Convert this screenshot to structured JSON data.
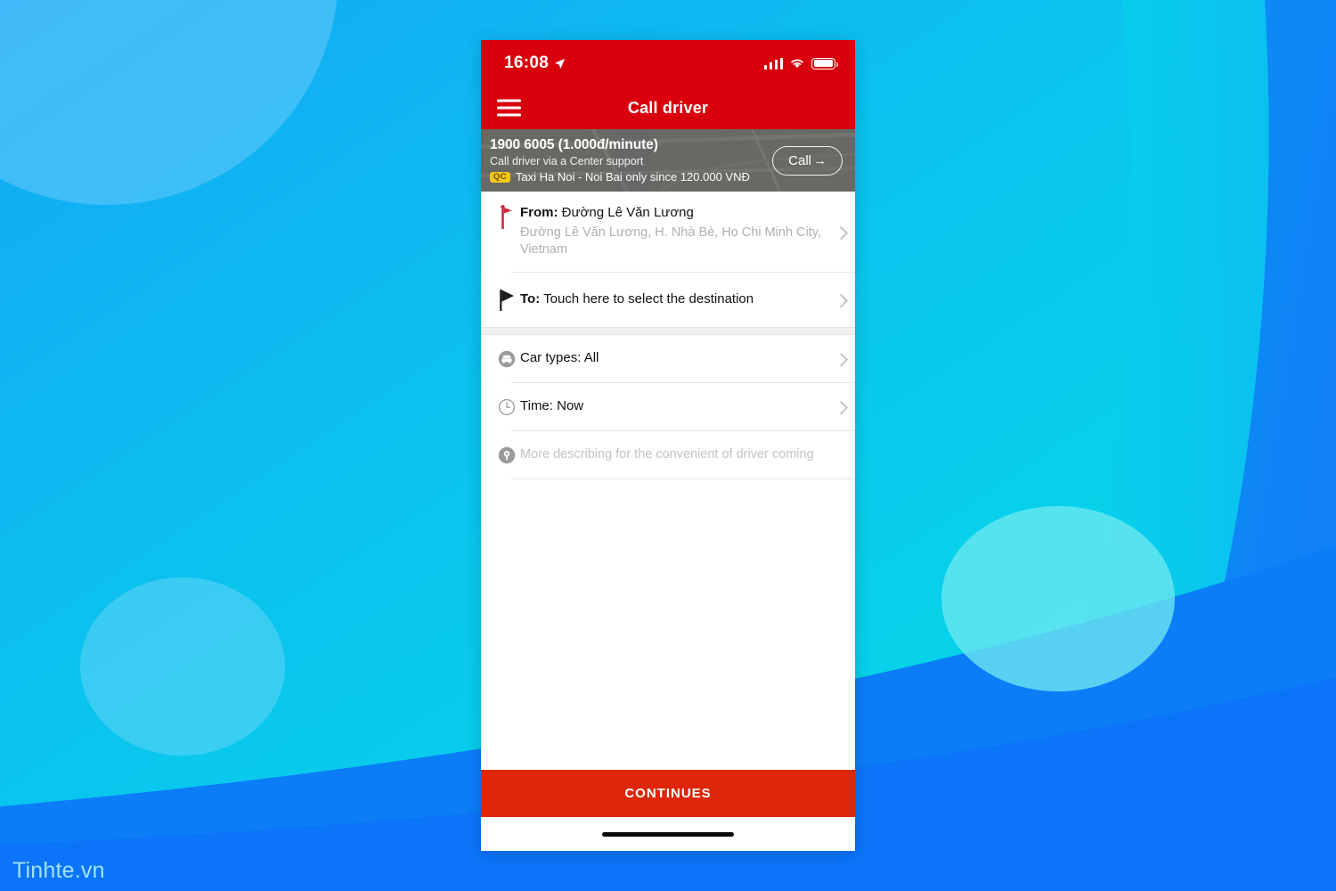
{
  "background": {
    "watermark": "Tinhte.vn",
    "colors": {
      "blue_start": "#13a6f5",
      "cyan_mid": "#06dbe8",
      "blue_wave": "#0a7cf7",
      "circle_light": "#59c4f7",
      "circle_cyan": "#6fe6f2"
    }
  },
  "phone": {
    "status_bar": {
      "time": "16:08",
      "location_icon": "location-arrow-icon",
      "signal_icon": "cellular-signal-icon",
      "wifi_icon": "wifi-icon",
      "battery_icon": "battery-full-icon",
      "background_color": "#d9000d"
    },
    "nav_bar": {
      "menu_icon": "hamburger-menu-icon",
      "title": "Call driver"
    },
    "promo_banner": {
      "phone_number": "1900 6005 (1.000đ/minute)",
      "subtitle": "Call driver via a Center support",
      "ad_badge": "QC",
      "ad_text": "Taxi Ha Noi - Noi Bai only since 120.000 VNĐ",
      "call_button": "Call",
      "call_button_arrow": "→"
    },
    "form": {
      "from_row": {
        "icon": "red-flag-marker-icon",
        "label": "From:",
        "value": "Đường Lê Văn Lương",
        "address": "Đường Lê Văn Lương, H. Nhà Bè, Ho Chi Minh City, Vietnam",
        "chevron": "chevron-right-icon"
      },
      "to_row": {
        "icon": "black-flag-icon",
        "label": "To:",
        "value": "Touch here to select the destination",
        "chevron": "chevron-right-icon"
      },
      "car_types_row": {
        "icon": "car-icon",
        "text": "Car types: All",
        "chevron": "chevron-right-icon"
      },
      "time_row": {
        "icon": "clock-icon",
        "text": "Time: Now",
        "chevron": "chevron-right-icon"
      },
      "note_row": {
        "icon": "map-pin-icon",
        "placeholder": "More describing for the convenient of driver coming"
      }
    },
    "continue_button": {
      "label": "CONTINUES",
      "color": "#de2609"
    },
    "home_indicator": "home-indicator-bar"
  }
}
